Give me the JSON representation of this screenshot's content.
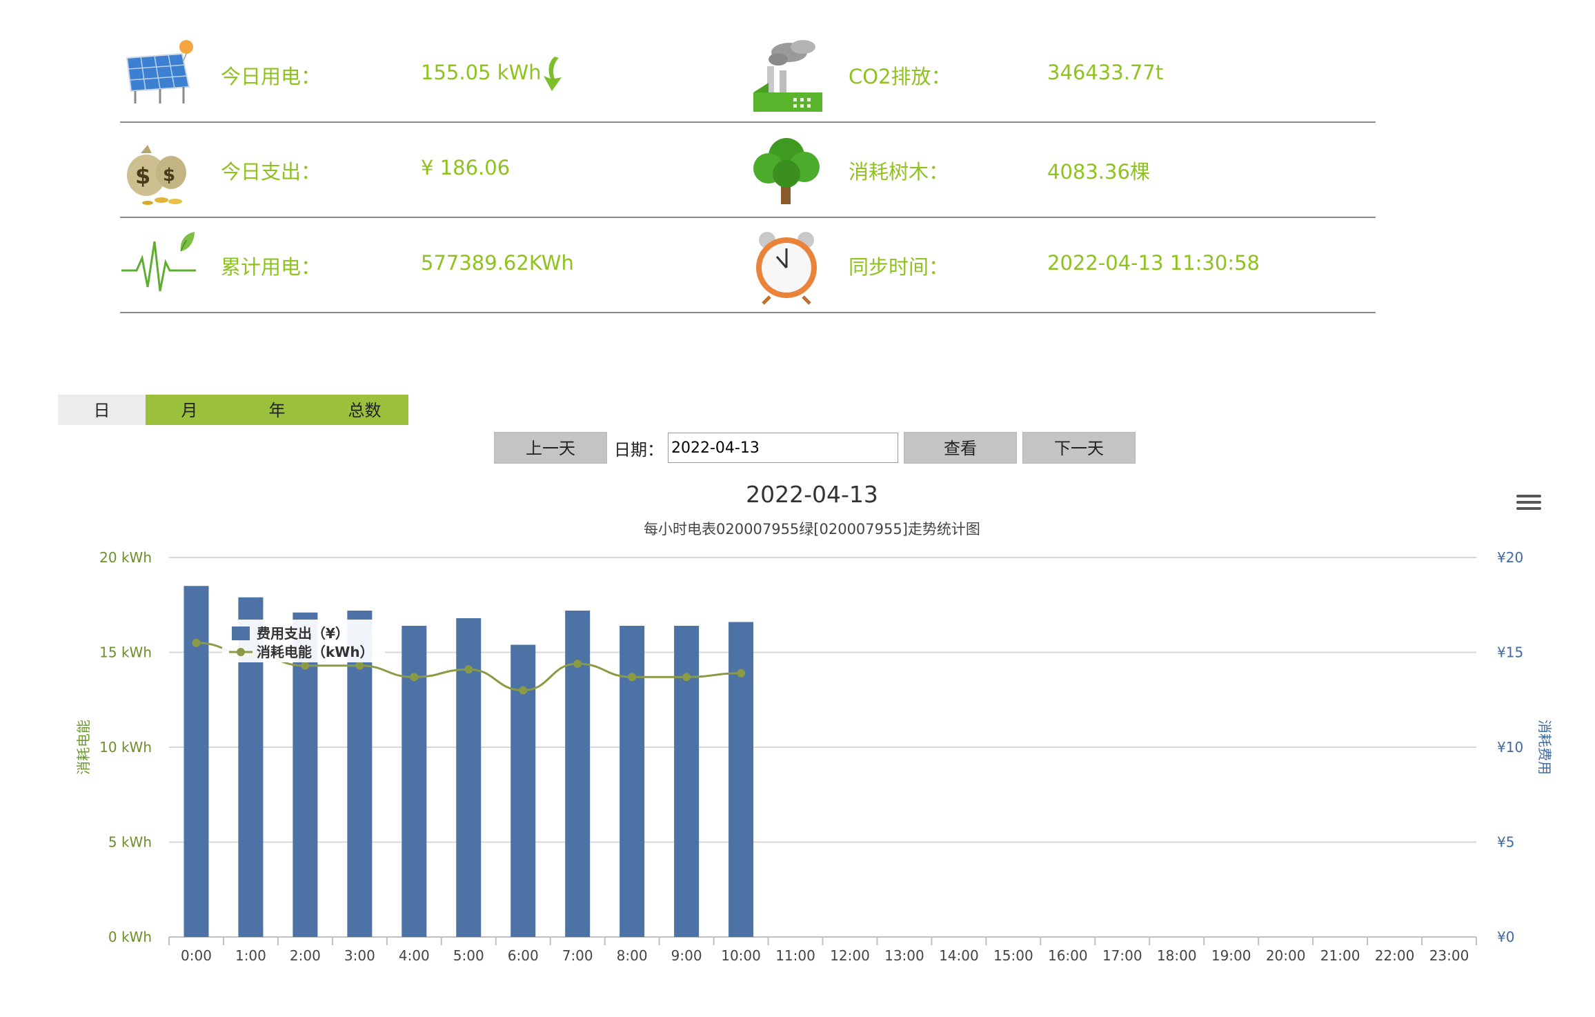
{
  "stats": {
    "rows": [
      {
        "left": {
          "icon": "solar-panel-icon",
          "label": "今日用电：",
          "value": "155.05 kWh"
        },
        "right": {
          "icon": "factory-icon",
          "label": "CO2排放：",
          "value": "346433.77t"
        }
      },
      {
        "left": {
          "icon": "money-bag-icon",
          "label": "今日支出：",
          "value": "¥ 186.06"
        },
        "right": {
          "icon": "tree-icon",
          "label": "消耗树木：",
          "value": "4083.36棵"
        }
      },
      {
        "left": {
          "icon": "pulse-leaf-icon",
          "label": "累计用电：",
          "value": "577389.62KWh"
        },
        "right": {
          "icon": "alarm-clock-icon",
          "label": "同步时间：",
          "value": "2022-04-13 11:30:58"
        }
      }
    ]
  },
  "tabs": [
    {
      "label": "日",
      "active": true
    },
    {
      "label": "月",
      "active": false
    },
    {
      "label": "年",
      "active": false
    },
    {
      "label": "总数",
      "active": false
    }
  ],
  "controls": {
    "prev_label": "上一天",
    "date_label": "日期：",
    "date_value": "2022-04-13",
    "view_label": "查看",
    "next_label": "下一天"
  },
  "colors": {
    "accent_green": "#8dc21f",
    "tab_green": "#9bc13c",
    "bar_blue": "#4d72a6",
    "line_green": "#8a9a45"
  },
  "chart_data": {
    "type": "bar+line",
    "title": "2022-04-13",
    "subtitle": "每小时电表020007955绿[020007955]走势统计图",
    "x": [
      "0:00",
      "1:00",
      "2:00",
      "3:00",
      "4:00",
      "5:00",
      "6:00",
      "7:00",
      "8:00",
      "9:00",
      "10:00",
      "11:00",
      "12:00",
      "13:00",
      "14:00",
      "15:00",
      "16:00",
      "17:00",
      "18:00",
      "19:00",
      "20:00",
      "21:00",
      "22:00",
      "23:00"
    ],
    "left_axis": {
      "label": "消耗电能",
      "ticks": [
        "0 kWh",
        "5 kWh",
        "10 kWh",
        "15 kWh",
        "20 kWh"
      ],
      "range": [
        0,
        20
      ]
    },
    "right_axis": {
      "label": "消耗费用",
      "ticks": [
        "¥0",
        "¥5",
        "¥10",
        "¥15",
        "¥20"
      ],
      "range": [
        0,
        20
      ]
    },
    "series": [
      {
        "name": "费用支出（¥）",
        "type": "bar",
        "axis": "right",
        "values": [
          18.5,
          17.9,
          17.1,
          17.2,
          16.4,
          16.8,
          15.4,
          17.2,
          16.4,
          16.4,
          16.6
        ]
      },
      {
        "name": "消耗电能（kWh）",
        "type": "line",
        "axis": "left",
        "values": [
          15.5,
          14.9,
          14.3,
          14.3,
          13.7,
          14.1,
          13.0,
          14.4,
          13.7,
          13.7,
          13.9
        ]
      }
    ],
    "grid": true,
    "legend": "top-left"
  }
}
